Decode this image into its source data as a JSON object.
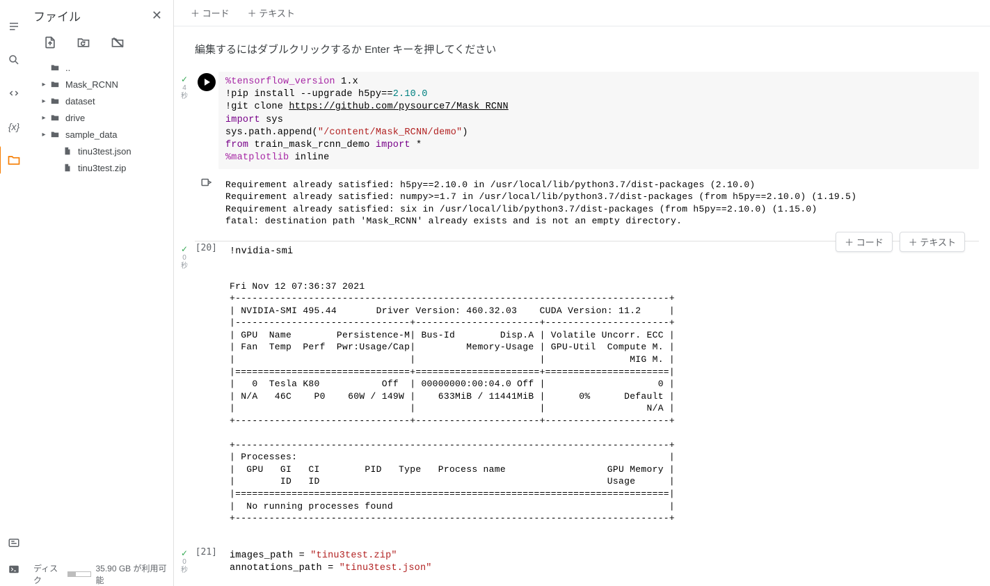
{
  "sidebar": {
    "title": "ファイル",
    "tree": {
      "up": "..",
      "items": [
        {
          "label": "Mask_RCNN",
          "type": "folder",
          "expandable": true
        },
        {
          "label": "dataset",
          "type": "folder",
          "expandable": true
        },
        {
          "label": "drive",
          "type": "folder",
          "expandable": true
        },
        {
          "label": "sample_data",
          "type": "folder",
          "expandable": true
        },
        {
          "label": "tinu3test.json",
          "type": "file",
          "expandable": false
        },
        {
          "label": "tinu3test.zip",
          "type": "file",
          "expandable": false
        }
      ]
    },
    "disk": {
      "label": "ディスク",
      "text": "35.90 GB が利用可能"
    }
  },
  "toolbar": {
    "code": "＋ コード",
    "text": "＋ テキスト"
  },
  "insert": {
    "code": "＋ コード",
    "text": "＋ テキスト"
  },
  "cells": {
    "text0": "編集するにはダブルクリックするか Enter キーを押してください",
    "c1": {
      "duration": "4",
      "unit": "秒",
      "code": {
        "l1a": "%tensorflow_version",
        "l1b": " 1.x",
        "l2a": "!pip install --upgrade h5py==",
        "l2b": "2.10.0",
        "l3a": "!git clone ",
        "l3b": "https://github.com/pysource7/Mask_RCNN",
        "l4a": "import",
        "l4b": " sys",
        "l5a": "sys.path.append(",
        "l5b": "\"/content/Mask_RCNN/demo\"",
        "l5c": ")",
        "l6a": "from",
        "l6b": " train_mask_rcnn_demo ",
        "l6c": "import",
        "l6d": " *",
        "l7a": "%matplotlib",
        "l7b": " inline"
      },
      "out": "Requirement already satisfied: h5py==2.10.0 in /usr/local/lib/python3.7/dist-packages (2.10.0)\nRequirement already satisfied: numpy>=1.7 in /usr/local/lib/python3.7/dist-packages (from h5py==2.10.0) (1.19.5)\nRequirement already satisfied: six in /usr/local/lib/python3.7/dist-packages (from h5py==2.10.0) (1.15.0)\nfatal: destination path 'Mask_RCNN' already exists and is not an empty directory."
    },
    "c2": {
      "prompt": "[20]",
      "duration": "0",
      "unit": "秒",
      "code": "!nvidia-smi",
      "out": "Fri Nov 12 07:36:37 2021       \n+-----------------------------------------------------------------------------+\n| NVIDIA-SMI 495.44       Driver Version: 460.32.03    CUDA Version: 11.2     |\n|-------------------------------+----------------------+----------------------+\n| GPU  Name        Persistence-M| Bus-Id        Disp.A | Volatile Uncorr. ECC |\n| Fan  Temp  Perf  Pwr:Usage/Cap|         Memory-Usage | GPU-Util  Compute M. |\n|                               |                      |               MIG M. |\n|===============================+======================+======================|\n|   0  Tesla K80           Off  | 00000000:00:04.0 Off |                    0 |\n| N/A   46C    P0    60W / 149W |    633MiB / 11441MiB |      0%      Default |\n|                               |                      |                  N/A |\n+-------------------------------+----------------------+----------------------+\n                                                                               \n+-----------------------------------------------------------------------------+\n| Processes:                                                                  |\n|  GPU   GI   CI        PID   Type   Process name                  GPU Memory |\n|        ID   ID                                                   Usage      |\n|=============================================================================|\n|  No running processes found                                                 |\n+-----------------------------------------------------------------------------+"
    },
    "c3": {
      "prompt": "[21]",
      "duration": "0",
      "unit": "秒",
      "code": {
        "l1a": "images_path = ",
        "l1b": "\"tinu3test.zip\"",
        "l2a": "annotations_path = ",
        "l2b": "\"tinu3test.json\""
      }
    }
  }
}
